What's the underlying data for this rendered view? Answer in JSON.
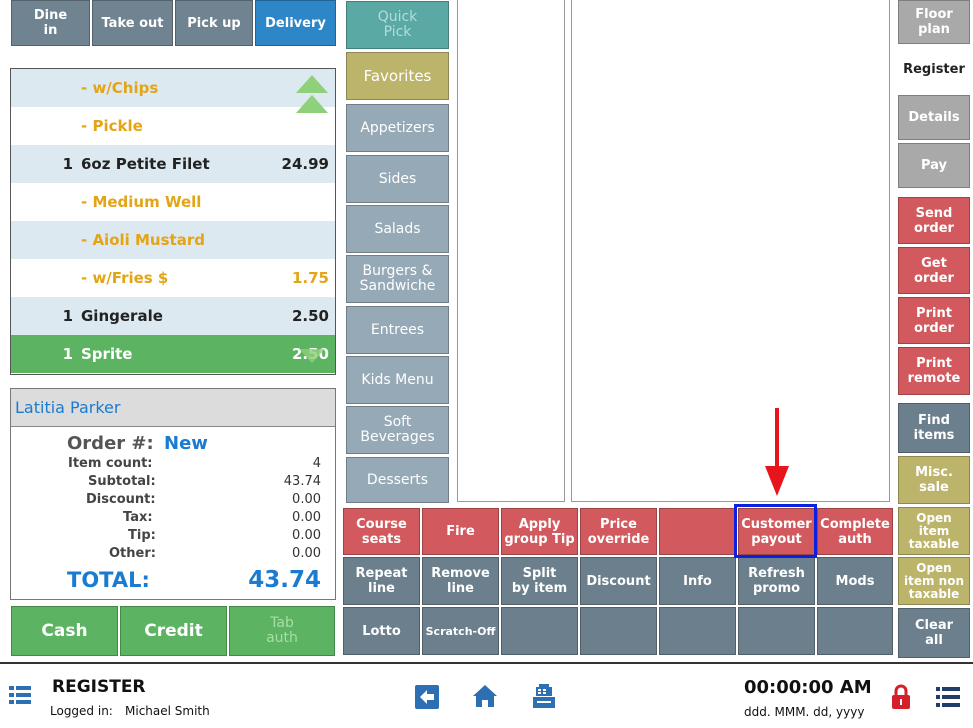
{
  "order_type_tabs": [
    {
      "label": "Dine\nin",
      "active": false
    },
    {
      "label": "Take out",
      "active": false
    },
    {
      "label": "Pick up",
      "active": false
    },
    {
      "label": "Delivery",
      "active": true
    }
  ],
  "order_items": [
    {
      "qty": "",
      "name": "- w/Chips",
      "price": "",
      "modifier": true
    },
    {
      "qty": "",
      "name": "- Pickle",
      "price": "",
      "modifier": true
    },
    {
      "qty": "1",
      "name": "6oz Petite Filet",
      "price": "24.99",
      "modifier": false
    },
    {
      "qty": "",
      "name": "- Medium Well",
      "price": "",
      "modifier": true
    },
    {
      "qty": "",
      "name": "- Aioli Mustard",
      "price": "",
      "modifier": true
    },
    {
      "qty": "",
      "name": "- w/Fries $",
      "price": "1.75",
      "modifier": true
    },
    {
      "qty": "1",
      "name": "Gingerale",
      "price": "2.50",
      "modifier": false
    },
    {
      "qty": "1",
      "name": "Sprite",
      "price": "2.50",
      "modifier": false,
      "selected": true
    }
  ],
  "summary": {
    "customer": "Latitia Parker",
    "order_label": "Order #:",
    "order_value": "New",
    "rows": [
      {
        "label": "Item count:",
        "value": "4"
      },
      {
        "label": "Subtotal:",
        "value": "43.74"
      },
      {
        "label": "Discount:",
        "value": "0.00"
      },
      {
        "label": "Tax:",
        "value": "0.00"
      },
      {
        "label": "Tip:",
        "value": "0.00"
      },
      {
        "label": "Other:",
        "value": "0.00"
      }
    ],
    "total_label": "TOTAL:",
    "total_value": "43.74"
  },
  "payment_buttons": {
    "cash": "Cash",
    "credit": "Credit",
    "tab_auth": "Tab\nauth"
  },
  "categories": [
    {
      "label": "Quick\nPick",
      "style": "teal"
    },
    {
      "label": "Favorites",
      "style": "olive"
    },
    {
      "label": "Appetizers",
      "style": "cat"
    },
    {
      "label": "Sides",
      "style": "cat"
    },
    {
      "label": "Salads",
      "style": "cat"
    },
    {
      "label": "Burgers &\nSandwiche",
      "style": "cat"
    },
    {
      "label": "Entrees",
      "style": "cat"
    },
    {
      "label": "Kids Menu",
      "style": "cat"
    },
    {
      "label": "Soft\nBeverages",
      "style": "cat"
    },
    {
      "label": "Desserts",
      "style": "cat"
    }
  ],
  "function_rows": [
    [
      {
        "label": "Course\nseats",
        "style": "red"
      },
      {
        "label": "Fire",
        "style": "red"
      },
      {
        "label": "Apply\ngroup Tip",
        "style": "red"
      },
      {
        "label": "Price\noverride",
        "style": "red"
      },
      {
        "label": "",
        "style": "red"
      },
      {
        "label": "Customer\npayout",
        "style": "red",
        "highlight": true
      },
      {
        "label": "Complete\nauth",
        "style": "red"
      }
    ],
    [
      {
        "label": "Repeat\nline",
        "style": "slate"
      },
      {
        "label": "Remove\nline",
        "style": "slate"
      },
      {
        "label": "Split\nby item",
        "style": "slate"
      },
      {
        "label": "Discount",
        "style": "slate"
      },
      {
        "label": "Info",
        "style": "slate"
      },
      {
        "label": "Refresh\npromo",
        "style": "slate"
      },
      {
        "label": "Mods",
        "style": "slate"
      }
    ],
    [
      {
        "label": "Lotto",
        "style": "slate"
      },
      {
        "label": "Scratch-Off",
        "style": "slate"
      },
      {
        "label": "",
        "style": "slate"
      },
      {
        "label": "",
        "style": "slate"
      },
      {
        "label": "",
        "style": "slate"
      },
      {
        "label": "",
        "style": "slate"
      },
      {
        "label": "",
        "style": "slate"
      }
    ]
  ],
  "side_buttons": [
    {
      "label": "Floor plan",
      "style": "lgray"
    },
    {
      "label": "Register",
      "style": "active"
    },
    {
      "label": "Details",
      "style": "lgray"
    },
    {
      "label": "Pay",
      "style": "lgray"
    },
    {
      "label": "Send\norder",
      "style": "red"
    },
    {
      "label": "Get\norder",
      "style": "red"
    },
    {
      "label": "Print\norder",
      "style": "red"
    },
    {
      "label": "Print\nremote",
      "style": "red"
    },
    {
      "label": "Find\nitems",
      "style": "slate"
    },
    {
      "label": "Misc.\nsale",
      "style": "olive"
    },
    {
      "label": "Open\nitem\ntaxable",
      "style": "olive"
    },
    {
      "label": "Open\nitem non\ntaxable",
      "style": "olive"
    },
    {
      "label": "Clear\nall",
      "style": "slate"
    }
  ],
  "bottom_bar": {
    "title": "REGISTER",
    "logged_in_label": "Logged in:",
    "user": "Michael Smith",
    "time": "00:00:00 AM",
    "date": "ddd. MMM. dd, yyyy"
  },
  "colors": {
    "accent_blue": "#2d86c8",
    "highlight_box": "#0a22e0",
    "arrow": "#e8141b",
    "total_blue": "#1a7bd0"
  }
}
